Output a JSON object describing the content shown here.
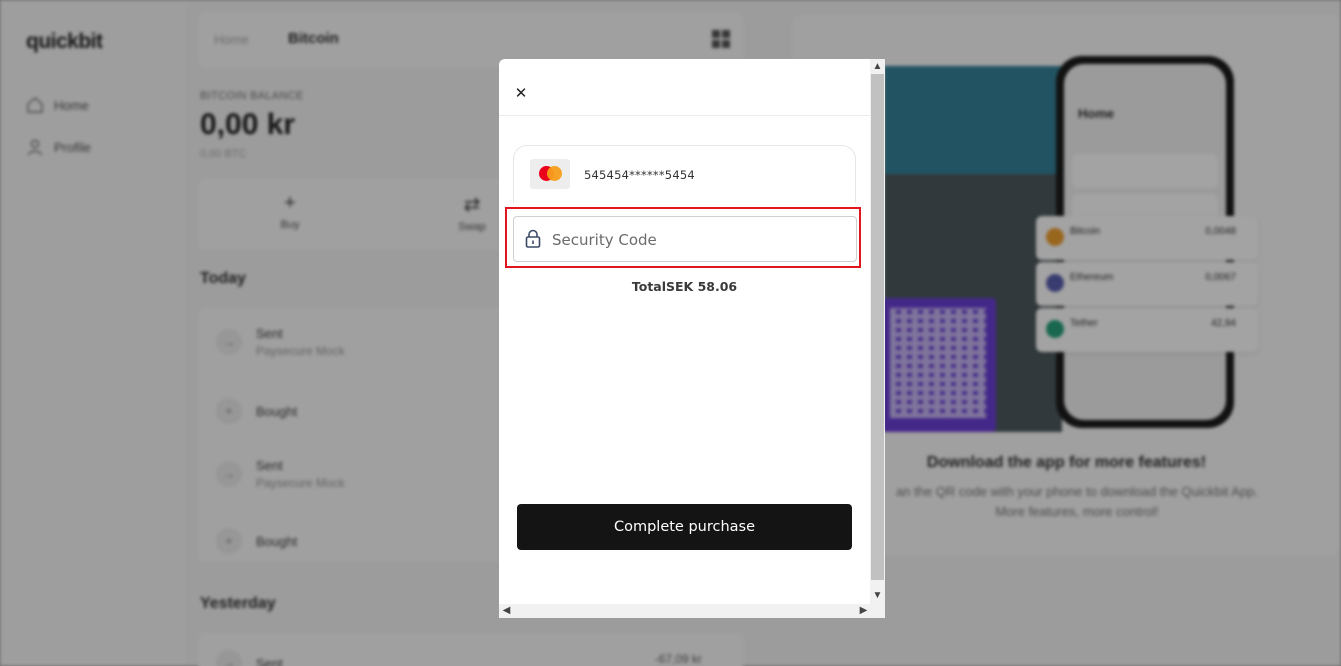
{
  "background": {
    "logo": "quickbit",
    "nav": {
      "home": "Home",
      "profile": "Profile"
    },
    "breadcrumb": {
      "root": "Home",
      "current": "Bitcoin"
    },
    "balance": {
      "label": "BITCOIN BALANCE",
      "amount": "0,00 kr",
      "btc": "0,00 BTC"
    },
    "actions": {
      "buy": "Buy",
      "swap": "Swap"
    },
    "sections": {
      "today": "Today",
      "yesterday": "Yesterday"
    },
    "transactions": [
      {
        "title": "Sent",
        "subtitle": "Paysecure Mock"
      },
      {
        "title": "Bought",
        "subtitle": ""
      },
      {
        "title": "Sent",
        "subtitle": "Paysecure Mock"
      },
      {
        "title": "Bought",
        "subtitle": ""
      },
      {
        "title": "Sent",
        "subtitle": "",
        "amount": "-67,09 kr"
      }
    ],
    "promo": {
      "heading": "Download the app for more features!",
      "text": "an the QR code with your phone to download the Quickbit App. More features, more control!",
      "phone_title": "Home",
      "coins": [
        {
          "name": "Bitcoin",
          "value": "0,0048",
          "color": "#f0a030"
        },
        {
          "name": "Ethereum",
          "value": "0,0067",
          "color": "#5a5fb0"
        },
        {
          "name": "Tether",
          "value": "42,94",
          "color": "#26a17b"
        }
      ]
    }
  },
  "modal": {
    "close_icon": "close-icon",
    "card": {
      "brand_icon": "mastercard-icon",
      "number": "545454******5454"
    },
    "security_code": {
      "placeholder": "Security Code",
      "value": "",
      "icon": "lock-icon"
    },
    "total": "TotalSEK 58.06",
    "complete_button": "Complete purchase",
    "highlight_color": "#e0151d"
  }
}
